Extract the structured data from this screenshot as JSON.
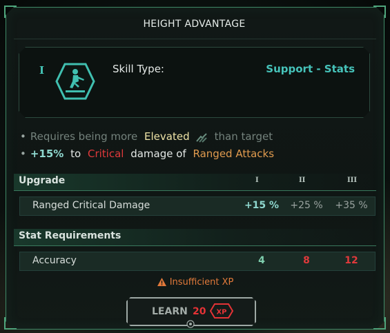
{
  "title": "HEIGHT ADVANTAGE",
  "skill": {
    "rank_numeral": "I",
    "type_label": "Skill Type:",
    "type_value": "Support - Stats"
  },
  "effects": {
    "line1": {
      "prefix": "Requires being more",
      "keyword": "Elevated",
      "suffix": "than target"
    },
    "line2": {
      "amount": "+15%",
      "to": "to",
      "keyword": "Critical",
      "middle": "damage of",
      "target": "Ranged Attacks"
    }
  },
  "upgrade": {
    "header": "Upgrade",
    "tiers": [
      "I",
      "II",
      "III"
    ],
    "row": {
      "label": "Ranged Critical Damage",
      "values": [
        "+15 %",
        "+25 %",
        "+35 %"
      ]
    }
  },
  "stat_requirements": {
    "header": "Stat Requirements",
    "row": {
      "label": "Accuracy",
      "values": [
        "4",
        "8",
        "12"
      ]
    }
  },
  "warning": "Insufficient XP",
  "learn_button": {
    "label": "LEARN",
    "cost": "20",
    "unit": "XP"
  },
  "colors": {
    "accent_teal": "#46c3ba",
    "danger_red": "#e0393b",
    "warning_orange": "#e1793a",
    "frame_green": "#3f8a67"
  },
  "icons": [
    "skill-figure-icon",
    "elevation-icon",
    "warning-icon",
    "xp-badge-icon"
  ]
}
